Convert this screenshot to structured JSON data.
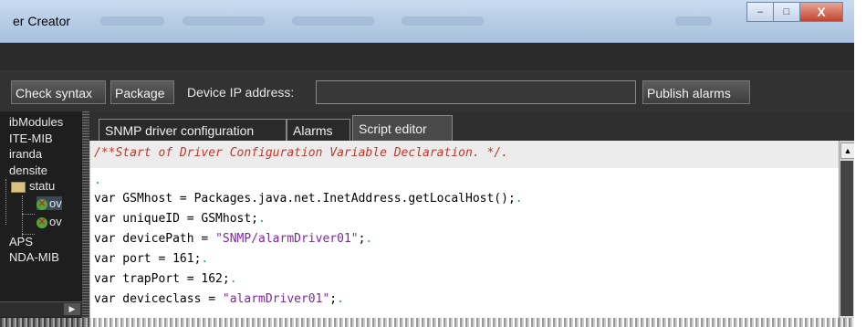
{
  "window": {
    "title": "er Creator",
    "controls": {
      "minimize": "–",
      "maximize": "□",
      "close": "X"
    }
  },
  "toolbar": {
    "check_syntax": "Check syntax",
    "package": "Package",
    "device_ip_label": "Device IP address:",
    "device_ip_value": "",
    "publish_alarms": "Publish alarms"
  },
  "tree": {
    "items": [
      {
        "label": "ibModules"
      },
      {
        "label": "ITE-MIB"
      },
      {
        "label": "iranda"
      },
      {
        "label": "densite"
      },
      {
        "label": "statu"
      },
      {
        "label": "ov"
      },
      {
        "label": "ov"
      },
      {
        "label": "APS"
      },
      {
        "label": "NDA-MIB"
      }
    ]
  },
  "tabs": [
    {
      "label": "SNMP driver configuration"
    },
    {
      "label": "Alarms"
    },
    {
      "label": "Script editor"
    }
  ],
  "editor": {
    "comment_line": "/**Start of Driver Configuration Variable Declaration. */.",
    "blank_dot": ".",
    "lines": [
      {
        "prefix": "var GSMhost = Packages.java.net.InetAddress.getLocalHost();",
        "str": "",
        "suffix": ""
      },
      {
        "prefix": "var uniqueID = GSMhost;",
        "str": "",
        "suffix": ""
      },
      {
        "prefix": "var devicePath = ",
        "str": "\"SNMP/alarmDriver01\"",
        "suffix": ";"
      },
      {
        "prefix": "var port = 161;",
        "str": "",
        "suffix": ""
      },
      {
        "prefix": "var trapPort = 162;",
        "str": "",
        "suffix": ""
      },
      {
        "prefix": "var deviceclass = ",
        "str": "\"alarmDriver01\"",
        "suffix": ";"
      }
    ],
    "line_end_marker": "."
  },
  "colors": {
    "comment": "#c0392b",
    "string": "#7a2a9c",
    "eol_marker": "#2c9a8a",
    "toolbar_bg": "#323232"
  }
}
